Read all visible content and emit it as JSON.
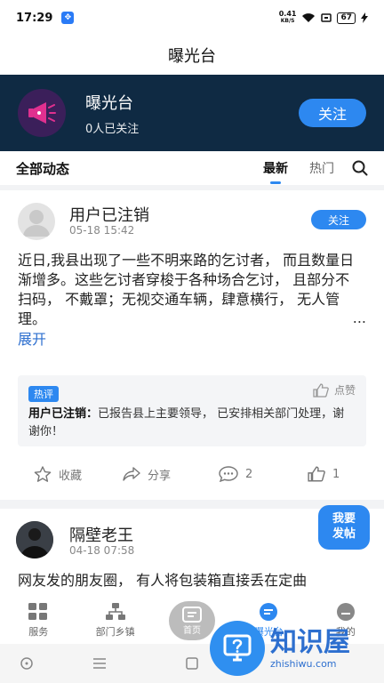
{
  "status_bar": {
    "time": "17:29",
    "net_speed_value": "0.41",
    "net_speed_unit": "KB/S",
    "battery": "67"
  },
  "page_title": "曝光台",
  "banner": {
    "name": "曝光台",
    "followers": "0人已关注",
    "follow_label": "关注"
  },
  "tabs": {
    "title": "全部动态",
    "items": [
      {
        "label": "最新",
        "active": true
      },
      {
        "label": "热门",
        "active": false
      }
    ]
  },
  "posts": [
    {
      "user": "用户已注销",
      "time": "05-18 15:42",
      "follow_label": "关注",
      "text": "近日,我县出现了一些不明来路的乞讨者， 而且数量日渐增多。这些乞讨者穿梭于各种场合乞讨， 且部分不扫码， 不戴罩；无视交通车辆，肆意横行， 无人管理。",
      "more": "...",
      "expand_label": "展开",
      "hot_comment": {
        "badge": "热评",
        "like_label": "点赞",
        "author": "用户已注销：",
        "text": "已报告县上主要领导， 已安排相关部门处理，谢谢你！"
      },
      "actions": {
        "collect": "收藏",
        "share": "分享",
        "comment_count": "2",
        "like_count": "1"
      }
    },
    {
      "user": "隔壁老王",
      "time": "04-18 07:58",
      "text": "网友发的朋友圈， 有人将包装箱直接丢在定曲"
    }
  ],
  "fab": {
    "line1": "我要",
    "line2": "发帖"
  },
  "bottom_nav": [
    {
      "label": "服务",
      "icon": "grid-icon"
    },
    {
      "label": "部门乡镇",
      "icon": "org-chart-icon"
    },
    {
      "label": "首页",
      "icon": "home-icon"
    },
    {
      "label": "曝光台",
      "icon": "exposure-icon",
      "active": true
    },
    {
      "label": "我的",
      "icon": "profile-icon"
    }
  ],
  "watermark": {
    "cn": "知识屋",
    "en": "zhishiwu.com"
  },
  "colors": {
    "accent": "#2d88f0",
    "banner_bg": "#0f2a43"
  }
}
